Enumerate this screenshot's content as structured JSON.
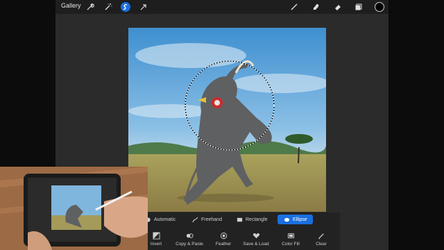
{
  "topbar": {
    "gallery_label": "Gallery",
    "left_icons": [
      "wrench-icon",
      "magic-wand-icon",
      "selection-icon",
      "transform-arrow-icon"
    ],
    "right_icons": [
      "brush-icon",
      "smudge-icon",
      "eraser-icon",
      "layers-icon",
      "color-icon"
    ],
    "active_tool": "selection",
    "accent_color": "#1a6fe0"
  },
  "selection_bar": {
    "modes": [
      {
        "label": "Automatic",
        "icon": "automatic-icon"
      },
      {
        "label": "Freehand",
        "icon": "freehand-icon"
      },
      {
        "label": "Rectangle",
        "icon": "rectangle-icon"
      },
      {
        "label": "Ellipse",
        "icon": "ellipse-icon"
      }
    ],
    "active_mode": "Ellipse",
    "actions": [
      {
        "label": "Invert",
        "icon": "invert-icon"
      },
      {
        "label": "Copy & Paste",
        "icon": "copy-paste-icon"
      },
      {
        "label": "Feather",
        "icon": "feather-icon"
      },
      {
        "label": "Save & Load",
        "icon": "heart-icon"
      },
      {
        "label": "Color Fill",
        "icon": "color-fill-icon"
      },
      {
        "label": "Clear",
        "icon": "clear-icon"
      }
    ]
  },
  "canvas": {
    "image": "elephant-dancing-photo",
    "selection_shape": "ellipse"
  },
  "overlay": {
    "image": "hand-holding-tablet-video"
  }
}
